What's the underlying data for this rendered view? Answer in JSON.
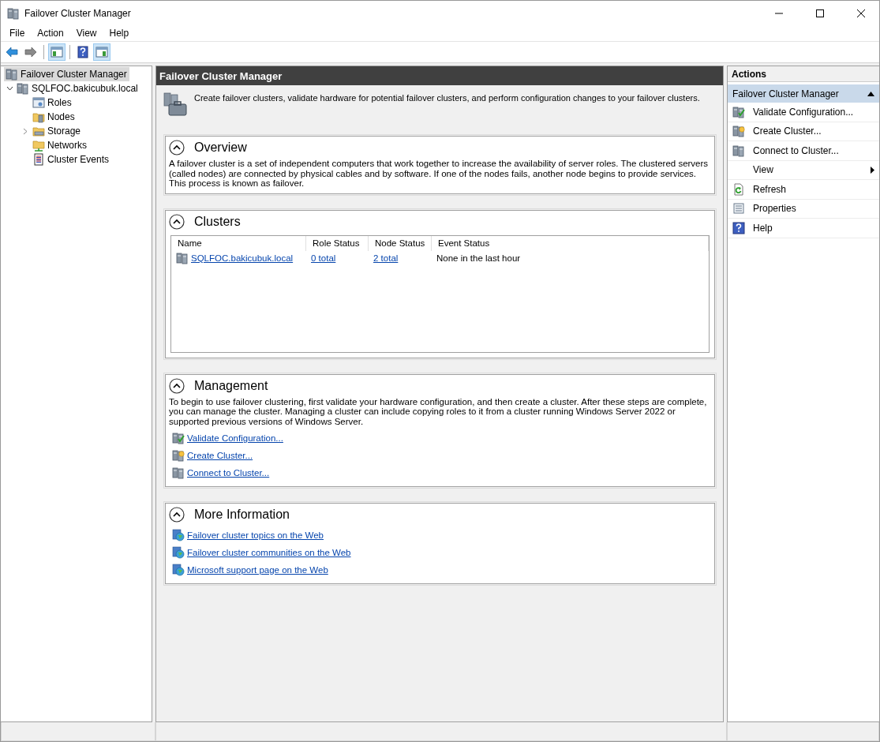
{
  "window": {
    "title": "Failover Cluster Manager"
  },
  "menu": [
    "File",
    "Action",
    "View",
    "Help"
  ],
  "toolbar": [
    {
      "kind": "back",
      "pressed": false
    },
    {
      "kind": "forward",
      "pressed": false
    },
    {
      "kind": "tree-toggle",
      "pressed": true
    },
    {
      "kind": "help",
      "pressed": false
    },
    {
      "kind": "actions-toggle",
      "pressed": true
    }
  ],
  "tree": {
    "label": "Failover Cluster Manager",
    "selected": true,
    "children": [
      {
        "label": "SQLFOC.bakicubuk.local",
        "selected": false,
        "expandable": true,
        "expanded": true,
        "kind": "cluster",
        "children": [
          {
            "label": "Roles",
            "selected": false,
            "expandable": false,
            "kind": "roles"
          },
          {
            "label": "Nodes",
            "selected": false,
            "expandable": false,
            "kind": "nodes"
          },
          {
            "label": "Storage",
            "selected": false,
            "expandable": true,
            "expanded": false,
            "kind": "storage"
          },
          {
            "label": "Networks",
            "selected": false,
            "expandable": false,
            "kind": "networks"
          },
          {
            "label": "Cluster Events",
            "selected": false,
            "expandable": false,
            "kind": "events"
          }
        ]
      }
    ]
  },
  "center": {
    "title": "Failover Cluster Manager",
    "description": "Create failover clusters, validate hardware for potential failover clusters, and perform configuration changes to your failover clusters.",
    "sections": [
      {
        "kind": "text",
        "title": "Overview",
        "expanded": true,
        "text": "A failover cluster is a set of independent computers that work together to increase the availability of server roles. The clustered servers (called nodes) are connected by physical cables and by software. If one of the nodes fails, another node begins to provide services. This process is known as failover."
      },
      {
        "kind": "table",
        "title": "Clusters",
        "expanded": true,
        "columns": [
          "Name",
          "Role Status",
          "Node Status",
          "Event Status"
        ],
        "rows": [
          {
            "name": "SQLFOC.bakicubuk.local",
            "role_status": "0 total",
            "node_status": "2 total",
            "event_status": "None in the last hour"
          }
        ]
      },
      {
        "kind": "links",
        "title": "Management",
        "expanded": true,
        "text": "To begin to use failover clustering, first validate your hardware configuration, and then create a cluster.  After these steps are complete, you can manage the cluster. Managing a cluster can include copying roles to it from a cluster running Windows Server 2022 or supported previous versions of Windows Server.",
        "links": [
          {
            "label": "Validate Configuration...",
            "kind": "validate"
          },
          {
            "label": "Create Cluster...",
            "kind": "create"
          },
          {
            "label": "Connect to Cluster...",
            "kind": "connect"
          }
        ]
      },
      {
        "kind": "links",
        "title": "More Information",
        "expanded": true,
        "links": [
          {
            "label": "Failover cluster topics on the Web",
            "kind": "web"
          },
          {
            "label": "Failover cluster communities on the Web",
            "kind": "web"
          },
          {
            "label": "Microsoft support page on the Web",
            "kind": "web"
          }
        ]
      }
    ]
  },
  "actions": {
    "title": "Actions",
    "group": {
      "title": "Failover Cluster Manager",
      "expanded": true
    },
    "items": [
      {
        "label": "Validate Configuration...",
        "kind": "validate",
        "submenu": false
      },
      {
        "label": "Create Cluster...",
        "kind": "create",
        "submenu": false
      },
      {
        "label": "Connect to Cluster...",
        "kind": "connect",
        "submenu": false
      },
      {
        "label": "View",
        "kind": "none",
        "submenu": true
      },
      {
        "label": "Refresh",
        "kind": "refresh",
        "submenu": false
      },
      {
        "label": "Properties",
        "kind": "properties",
        "submenu": false
      },
      {
        "label": "Help",
        "kind": "help",
        "submenu": false
      }
    ]
  }
}
